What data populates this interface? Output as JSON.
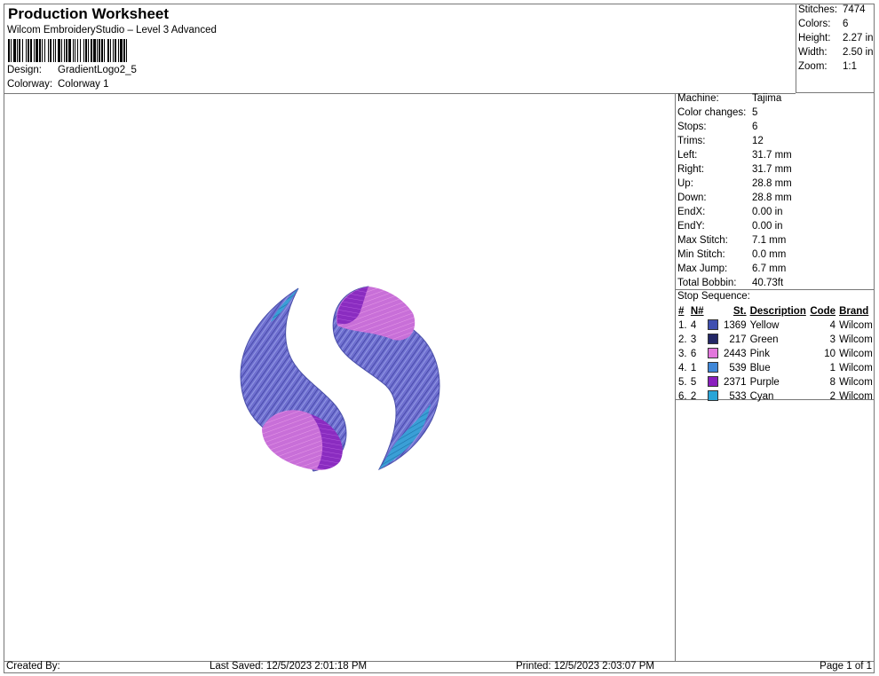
{
  "header": {
    "title": "Production Worksheet",
    "subtitle": "Wilcom EmbroideryStudio – Level 3 Advanced",
    "design_label": "Design:",
    "design_value": "GradientLogo2_5",
    "colorway_label": "Colorway:",
    "colorway_value": "Colorway 1"
  },
  "summary": [
    {
      "label": "Stitches:",
      "value": "7474"
    },
    {
      "label": "Colors:",
      "value": "6"
    },
    {
      "label": "Height:",
      "value": "2.27 in"
    },
    {
      "label": "Width:",
      "value": "2.50 in"
    },
    {
      "label": "Zoom:",
      "value": "1:1"
    }
  ],
  "properties": [
    {
      "label": "Machine:",
      "value": "Tajima"
    },
    {
      "label": "Color changes:",
      "value": "5"
    },
    {
      "label": "Stops:",
      "value": "6"
    },
    {
      "label": "Trims:",
      "value": "12"
    },
    {
      "label": "Left:",
      "value": "31.7 mm"
    },
    {
      "label": "Right:",
      "value": "31.7 mm"
    },
    {
      "label": "Up:",
      "value": "28.8 mm"
    },
    {
      "label": "Down:",
      "value": "28.8 mm"
    },
    {
      "label": "EndX:",
      "value": "0.00 in"
    },
    {
      "label": "EndY:",
      "value": "0.00 in"
    },
    {
      "label": "Max Stitch:",
      "value": "7.1 mm"
    },
    {
      "label": "Min Stitch:",
      "value": "0.0 mm"
    },
    {
      "label": "Max Jump:",
      "value": "6.7 mm"
    },
    {
      "label": "Total Bobbin:",
      "value": "40.73ft"
    }
  ],
  "stop_sequence": {
    "title": "Stop Sequence:",
    "columns": {
      "hash": "#",
      "n": "N#",
      "st": "St.",
      "description": "Description",
      "code": "Code",
      "brand": "Brand"
    },
    "rows": [
      {
        "index": "1.",
        "n": "4",
        "color": "#3f4fb0",
        "st": "1369",
        "description": "Yellow",
        "code": "4",
        "brand": "Wilcom"
      },
      {
        "index": "2.",
        "n": "3",
        "color": "#232766",
        "st": "217",
        "description": "Green",
        "code": "3",
        "brand": "Wilcom"
      },
      {
        "index": "3.",
        "n": "6",
        "color": "#e277dc",
        "st": "2443",
        "description": "Pink",
        "code": "10",
        "brand": "Wilcom"
      },
      {
        "index": "4.",
        "n": "1",
        "color": "#3f87d8",
        "st": "539",
        "description": "Blue",
        "code": "1",
        "brand": "Wilcom"
      },
      {
        "index": "5.",
        "n": "5",
        "color": "#8a1fbe",
        "st": "2371",
        "description": "Purple",
        "code": "8",
        "brand": "Wilcom"
      },
      {
        "index": "6.",
        "n": "2",
        "color": "#2aa5d8",
        "st": "533",
        "description": "Cyan",
        "code": "2",
        "brand": "Wilcom"
      }
    ]
  },
  "footer": {
    "created_by": "Created By:",
    "last_saved": "Last Saved: 12/5/2023 2:01:18 PM",
    "printed": "Printed: 12/5/2023 2:03:07 PM",
    "page": "Page 1 of 1"
  }
}
